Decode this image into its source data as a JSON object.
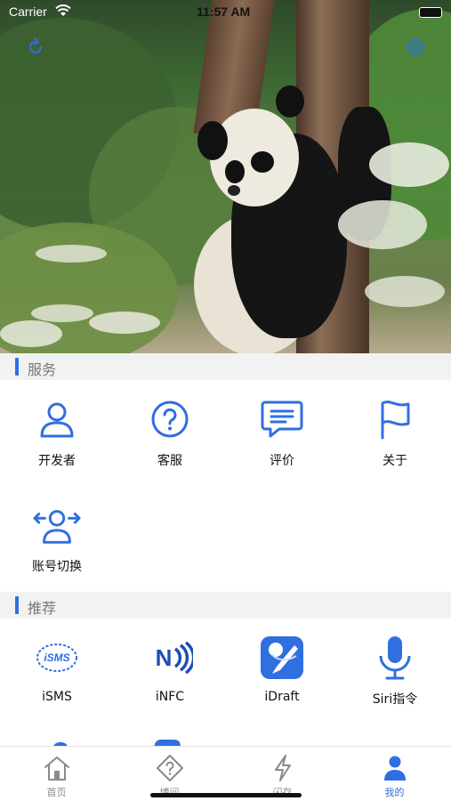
{
  "status_bar": {
    "carrier": "Carrier",
    "time": "11:57 AM"
  },
  "hero": {
    "image": "giant panda hugging a tree",
    "refresh_icon": "refresh-icon",
    "settings_icon": "settings-icon"
  },
  "services": {
    "title": "服务",
    "items": [
      {
        "label": "开发者",
        "icon": "user-icon"
      },
      {
        "label": "客服",
        "icon": "question-circle-icon"
      },
      {
        "label": "评价",
        "icon": "comment-icon"
      },
      {
        "label": "关于",
        "icon": "flag-icon"
      },
      {
        "label": "账号切换",
        "icon": "account-switch-icon"
      }
    ]
  },
  "recommend": {
    "title": "推荐",
    "items": [
      {
        "label": "iSMS",
        "icon": "isms-app-icon"
      },
      {
        "label": "iNFC",
        "icon": "nfc-app-icon"
      },
      {
        "label": "iDraft",
        "icon": "idraft-app-icon"
      },
      {
        "label": "Siri指令",
        "icon": "microphone-icon"
      }
    ]
  },
  "tabbar": {
    "tabs": [
      {
        "label": "首页",
        "icon": "home-icon",
        "active": false
      },
      {
        "label": "博问",
        "icon": "question-diamond-icon",
        "active": false
      },
      {
        "label": "闪存",
        "icon": "lightning-icon",
        "active": false
      },
      {
        "label": "我的",
        "icon": "person-icon",
        "active": true
      }
    ]
  },
  "colors": {
    "accent": "#2f6fe0",
    "section_bg": "#f2f2f2",
    "inactive": "#8a8a8a"
  }
}
